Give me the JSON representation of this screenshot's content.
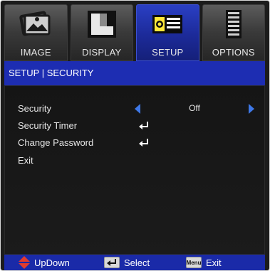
{
  "tabs": [
    {
      "label": "IMAGE",
      "icon": "image-icon",
      "active": false
    },
    {
      "label": "DISPLAY",
      "icon": "display-icon",
      "active": false
    },
    {
      "label": "SETUP",
      "icon": "setup-icon",
      "active": true
    },
    {
      "label": "OPTIONS",
      "icon": "options-icon",
      "active": false
    }
  ],
  "breadcrumb": "SETUP | SECURITY",
  "menu": {
    "security": {
      "label": "Security",
      "value": "Off"
    },
    "security_timer": {
      "label": "Security Timer"
    },
    "change_password": {
      "label": "Change Password"
    },
    "exit": {
      "label": "Exit"
    }
  },
  "footer": {
    "updown": "UpDown",
    "select": "Select",
    "menu_key": "Menu",
    "exit": "Exit"
  },
  "colors": {
    "active_tab": "#1d2db2",
    "highlight_bar": "#1d2db2",
    "arrow": "#3e78e8",
    "updown_icon": "#e23b2e"
  }
}
